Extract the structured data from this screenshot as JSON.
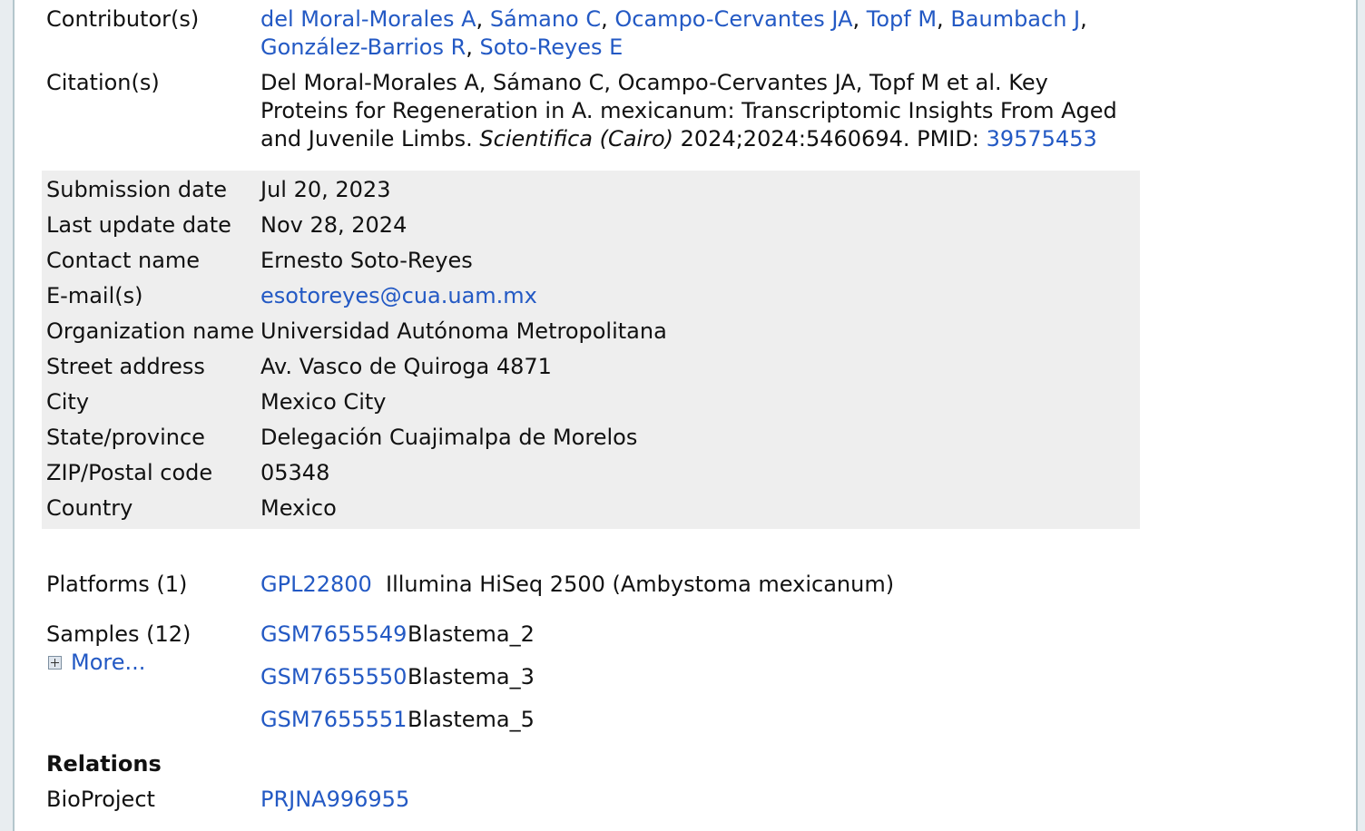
{
  "contributors": {
    "label": "Contributor(s)",
    "line1": [
      {
        "name": "del Moral-Morales A",
        "sep": ", "
      },
      {
        "name": "Sámano C",
        "sep": ", "
      },
      {
        "name": "Ocampo-Cervantes JA",
        "sep": ", "
      },
      {
        "name": "Topf M",
        "sep": ", "
      },
      {
        "name": "Baumbach J",
        "sep": ","
      }
    ],
    "line2": [
      {
        "name": "González-Barrios R",
        "sep": ", "
      },
      {
        "name": "Soto-Reyes E",
        "sep": ""
      }
    ]
  },
  "citation": {
    "label": "Citation(s)",
    "line1": "Del Moral-Morales A, Sámano C, Ocampo-Cervantes JA, Topf M et al. Key",
    "line2": "Proteins for Regeneration in A. mexicanum: Transcriptomic Insights From Aged",
    "line3_pre": "and Juvenile Limbs. ",
    "journal": "Scientifica (Cairo)",
    "line3_post": " 2024;2024:5460694. PMID: ",
    "pmid": "39575453"
  },
  "contact": {
    "submission_label": "Submission date",
    "submission": "Jul 20, 2023",
    "update_label": "Last update date",
    "update": "Nov 28, 2024",
    "name_label": "Contact name",
    "name": "Ernesto Soto-Reyes",
    "email_label": "E-mail(s)",
    "email": "esotoreyes@cua.uam.mx",
    "org_label": "Organization name",
    "org": "Universidad Autónoma Metropolitana",
    "street_label": "Street address",
    "street": "Av. Vasco de Quiroga 4871",
    "city_label": "City",
    "city": "Mexico City",
    "state_label": "State/province",
    "state": "Delegación Cuajimalpa de Morelos",
    "zip_label": "ZIP/Postal code",
    "zip": "05348",
    "country_label": "Country",
    "country": "Mexico"
  },
  "platforms": {
    "label": "Platforms (1)",
    "items": [
      {
        "acc": "GPL22800",
        "desc": "Illumina HiSeq 2500 (Ambystoma mexicanum)"
      }
    ]
  },
  "samples": {
    "label": "Samples (12)",
    "more": "More...",
    "items": [
      {
        "acc": "GSM7655549",
        "desc": "Blastema_2"
      },
      {
        "acc": "GSM7655550",
        "desc": "Blastema_3"
      },
      {
        "acc": "GSM7655551",
        "desc": "Blastema_5"
      }
    ]
  },
  "relations": {
    "heading": "Relations",
    "bioproject_label": "BioProject",
    "bioproject": "PRJNA996955"
  }
}
